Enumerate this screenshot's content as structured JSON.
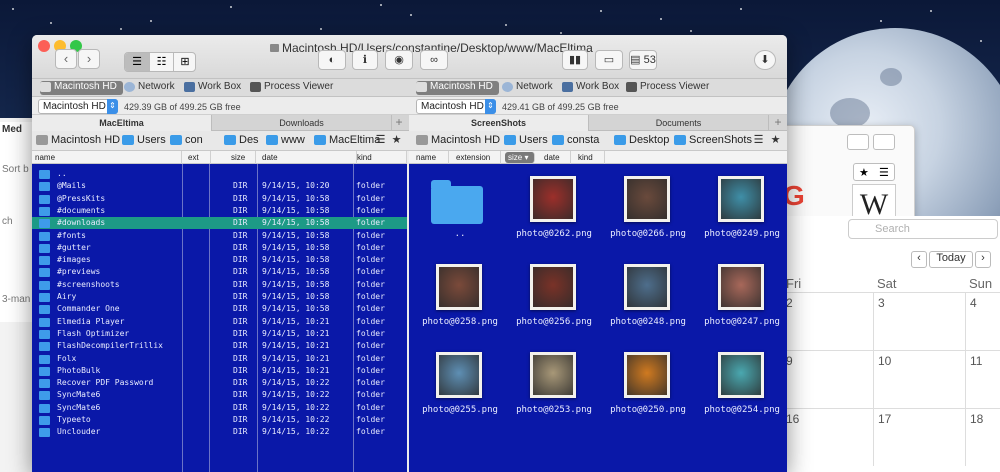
{
  "window": {
    "title": "Macintosh HD/Users/constantine/Desktop/www/MacEltima",
    "disk_count": "53"
  },
  "tabs": {
    "left": [
      "Macintosh HD",
      "Network",
      "Work Box",
      "Process Viewer"
    ],
    "right": [
      "Macintosh HD",
      "Network",
      "Work Box",
      "Process Viewer"
    ]
  },
  "devices": {
    "left": {
      "name": "Macintosh HD",
      "free": "429.39 GB of 499.25 GB free"
    },
    "right": {
      "name": "Macintosh HD",
      "free": "429.41 GB of 499.25 GB free"
    }
  },
  "panel_tabs": {
    "left": [
      "MacEltima",
      "Downloads"
    ],
    "right": [
      "ScreenShots",
      "Documents"
    ],
    "add_label": "+"
  },
  "breadcrumbs": {
    "left": [
      "Macintosh HD",
      "Users",
      "constantine",
      "Desktop",
      "www",
      "MacEltima"
    ],
    "left_shown": [
      "Macintosh HD",
      "Users",
      "con",
      "Des",
      "www",
      "MacEltima"
    ],
    "right": [
      "Macintosh HD",
      "Users",
      "constantine",
      "Desktop",
      "ScreenShots"
    ],
    "right_shown": [
      "Macintosh HD",
      "Users",
      "consta",
      "Desktop",
      "ScreenShots"
    ],
    "bookmark_label": "★"
  },
  "left_columns": [
    "name",
    "ext",
    "size",
    "date",
    "kind"
  ],
  "right_columns": [
    "name",
    "extension",
    "size ▾",
    "date",
    "kind"
  ],
  "left_rows": [
    {
      "name": "..",
      "size": "",
      "date": "",
      "kind": ""
    },
    {
      "name": "@Mails",
      "size": "DIR",
      "date": "9/14/15, 10:20",
      "kind": "folder"
    },
    {
      "name": "@PressKits",
      "size": "DIR",
      "date": "9/14/15, 10:58",
      "kind": "folder"
    },
    {
      "name": "#documents",
      "size": "DIR",
      "date": "9/14/15, 10:58",
      "kind": "folder"
    },
    {
      "name": "#downloads",
      "size": "DIR",
      "date": "9/14/15, 10:58",
      "kind": "folder"
    },
    {
      "name": "#fonts",
      "size": "DIR",
      "date": "9/14/15, 10:58",
      "kind": "folder"
    },
    {
      "name": "#gutter",
      "size": "DIR",
      "date": "9/14/15, 10:58",
      "kind": "folder"
    },
    {
      "name": "#images",
      "size": "DIR",
      "date": "9/14/15, 10:58",
      "kind": "folder"
    },
    {
      "name": "#previews",
      "size": "DIR",
      "date": "9/14/15, 10:58",
      "kind": "folder"
    },
    {
      "name": "#screenshoots",
      "size": "DIR",
      "date": "9/14/15, 10:58",
      "kind": "folder"
    },
    {
      "name": "Airy",
      "size": "DIR",
      "date": "9/14/15, 10:58",
      "kind": "folder"
    },
    {
      "name": "Commander One",
      "size": "DIR",
      "date": "9/14/15, 10:58",
      "kind": "folder"
    },
    {
      "name": "Elmedia Player",
      "size": "DIR",
      "date": "9/14/15, 10:21",
      "kind": "folder"
    },
    {
      "name": "Flash Optimizer",
      "size": "DIR",
      "date": "9/14/15, 10:21",
      "kind": "folder"
    },
    {
      "name": "FlashDecompilerTrillix",
      "size": "DIR",
      "date": "9/14/15, 10:21",
      "kind": "folder"
    },
    {
      "name": "Folx",
      "size": "DIR",
      "date": "9/14/15, 10:21",
      "kind": "folder"
    },
    {
      "name": "PhotoBulk",
      "size": "DIR",
      "date": "9/14/15, 10:21",
      "kind": "folder"
    },
    {
      "name": "Recover PDF Password",
      "size": "DIR",
      "date": "9/14/15, 10:22",
      "kind": "folder"
    },
    {
      "name": "SyncMate6",
      "size": "DIR",
      "date": "9/14/15, 10:22",
      "kind": "folder"
    },
    {
      "name": "SyncMate6",
      "size": "DIR",
      "date": "9/14/15, 10:22",
      "kind": "folder"
    },
    {
      "name": "Typeeto",
      "size": "DIR",
      "date": "9/14/15, 10:22",
      "kind": "folder"
    },
    {
      "name": "Unclouder",
      "size": "DIR",
      "date": "9/14/15, 10:22",
      "kind": "folder"
    }
  ],
  "right_items": [
    {
      "name": "..",
      "kind": "folder"
    },
    {
      "name": "photo@0262.png",
      "color": "#9c2f2a"
    },
    {
      "name": "photo@0266.png",
      "color": "#6a4a3c"
    },
    {
      "name": "photo@0249.png",
      "color": "#3f8fa8"
    },
    {
      "name": "photo@0258.png",
      "color": "#7b4a3a"
    },
    {
      "name": "photo@0256.png",
      "color": "#7a3228"
    },
    {
      "name": "photo@0248.png",
      "color": "#4e6e8c"
    },
    {
      "name": "photo@0247.png",
      "color": "#a8685a"
    },
    {
      "name": "photo@0255.png",
      "color": "#5e8fb4"
    },
    {
      "name": "photo@0253.png",
      "color": "#a89878"
    },
    {
      "name": "photo@0250.png",
      "color": "#d07a20"
    },
    {
      "name": "photo@0254.png",
      "color": "#4aa8b0"
    }
  ],
  "calendar": {
    "search_placeholder": "Search",
    "today_label": "Today",
    "headers": [
      "Fri",
      "Sat",
      "Sun"
    ],
    "week1": [
      "2",
      "3",
      "4"
    ],
    "week2": [
      "9",
      "10",
      "11"
    ],
    "week3": [
      "16",
      "17",
      "18"
    ]
  },
  "bg_left": {
    "label1": "Med",
    "label2": "Sort b",
    "label3": "ch",
    "label4": "3-man"
  },
  "accent": {
    "selection": "#1d9a86",
    "panel_bg": "#0a18a8",
    "folder": "#3e9bea"
  }
}
